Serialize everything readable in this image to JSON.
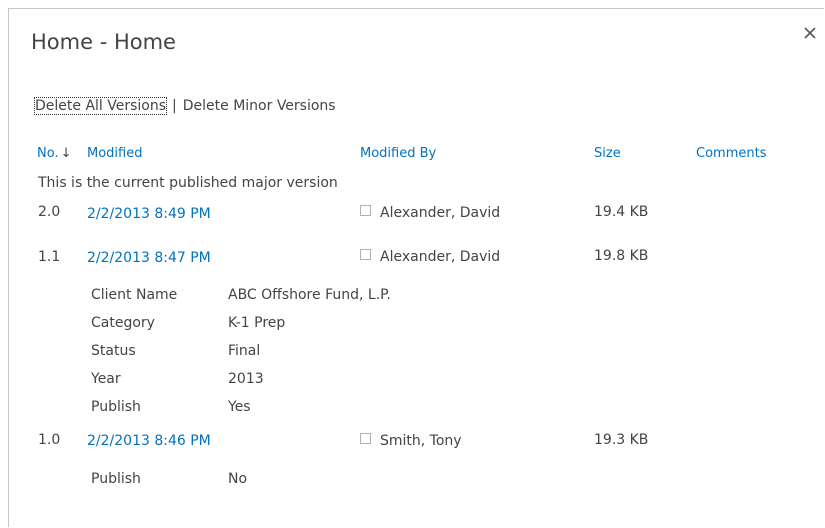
{
  "dialog": {
    "title": "Home - Home",
    "close_glyph": "✕"
  },
  "actions": {
    "delete_all": "Delete All Versions",
    "separator": "|",
    "delete_minor": "Delete Minor Versions"
  },
  "columns": {
    "no": "No.",
    "sort_arrow": "↓",
    "modified": "Modified",
    "modified_by": "Modified By",
    "size": "Size",
    "comments": "Comments"
  },
  "current_note": "This is the current published major version",
  "versions": [
    {
      "no": "2.0",
      "modified": "2/2/2013 8:49 PM",
      "modified_by": "Alexander, David",
      "size": "19.4 KB",
      "properties": []
    },
    {
      "no": "1.1",
      "modified": "2/2/2013 8:47 PM",
      "modified_by": "Alexander, David",
      "size": "19.8 KB",
      "properties": [
        {
          "label": "Client Name",
          "value": "ABC Offshore Fund, L.P."
        },
        {
          "label": "Category",
          "value": "K-1 Prep"
        },
        {
          "label": "Status",
          "value": "Final"
        },
        {
          "label": "Year",
          "value": "2013"
        },
        {
          "label": "Publish",
          "value": "Yes"
        }
      ]
    },
    {
      "no": "1.0",
      "modified": "2/2/2013 8:46 PM",
      "modified_by": "Smith, Tony",
      "size": "19.3 KB",
      "properties": [
        {
          "label": "Publish",
          "value": "No"
        }
      ]
    }
  ],
  "colors": {
    "link": "#0072c6",
    "text": "#444444"
  },
  "icons": {
    "close": "close-icon",
    "presence": "presence-icon",
    "sort": "sort-descending-icon"
  }
}
